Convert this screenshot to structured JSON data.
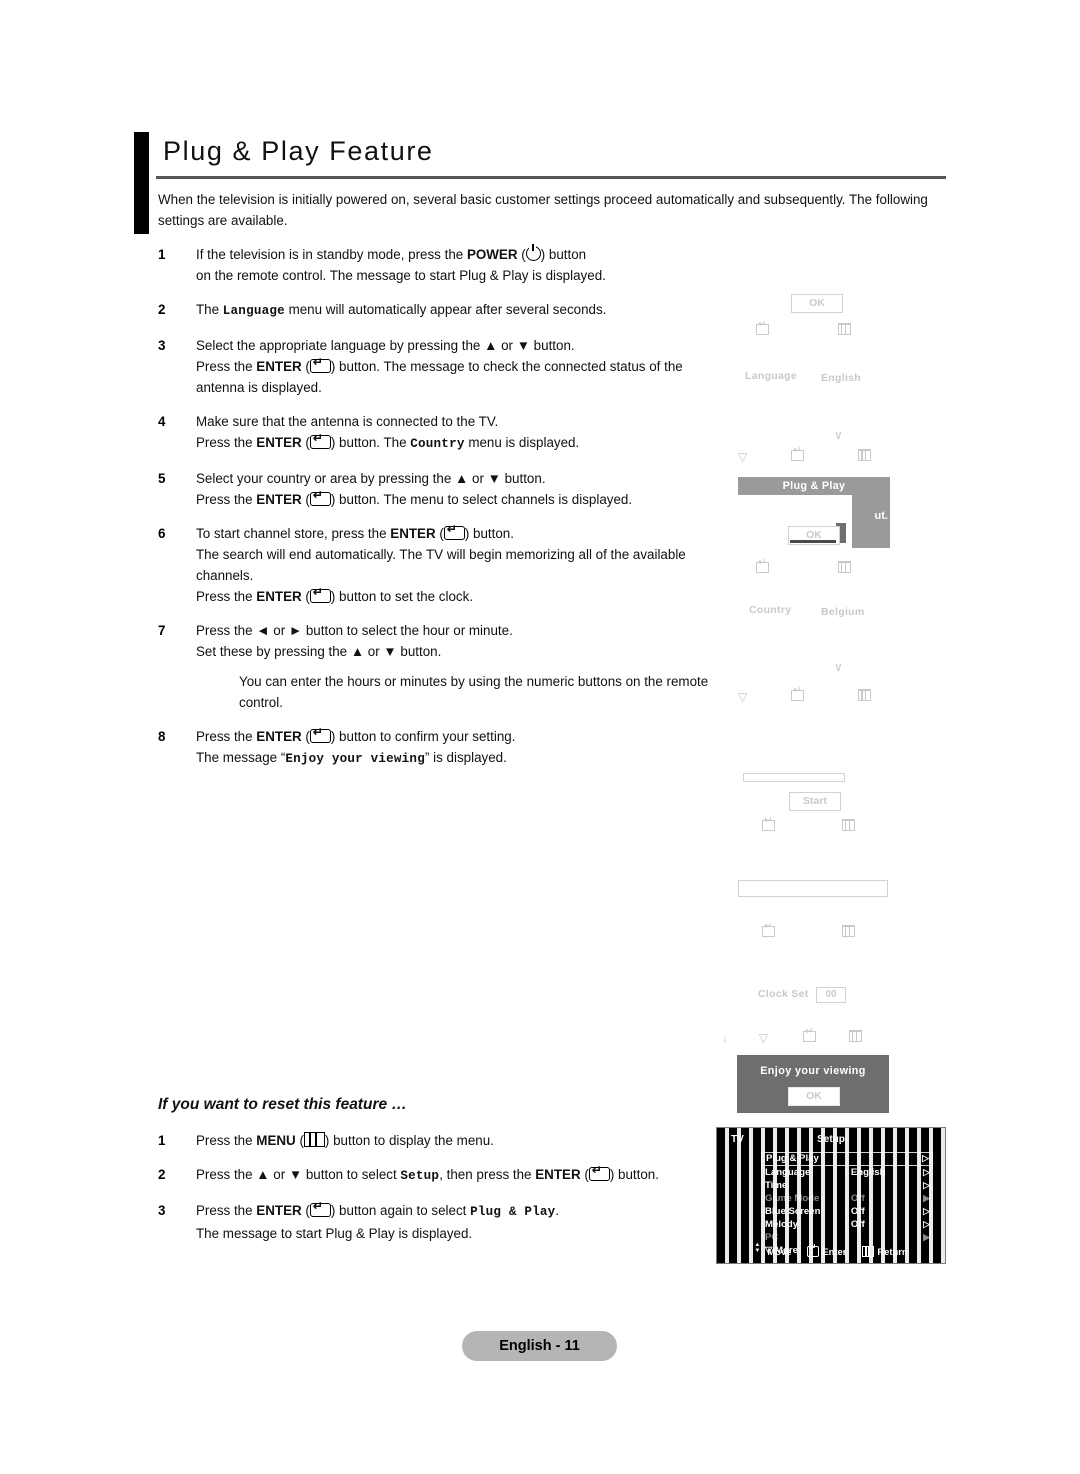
{
  "header": {
    "title": "Plug & Play Feature",
    "intro": "When the television is initially powered on, several basic customer settings proceed automatically and subsequently. The following settings are available."
  },
  "steps_main": [
    {
      "num": "1",
      "line1_a": "If the television is in standby mode, press the ",
      "bold1": "POWER",
      "line1_b": " (",
      "icon1": "power-icon",
      "line1_c": ") button",
      "line2": "on the remote control. The message to start Plug & Play is displayed."
    },
    {
      "num": "2",
      "pre": "The ",
      "mono": "Language",
      "post": " menu will automatically appear after several seconds."
    },
    {
      "num": "3",
      "l1": "Select the appropriate language by pressing the ▲ or ▼ button.",
      "l2a": "Press the ",
      "l2b": "ENTER",
      "l2c": " (",
      "l2d": ") button. The message to check the connected status of the antenna is displayed."
    },
    {
      "num": "4",
      "l1": "Make sure that the antenna is connected to the TV.",
      "l2a": "Press the ",
      "l2b": "ENTER",
      "l2c": " (",
      "l2d": ") button. The ",
      "l2mono": "Country",
      "l2e": " menu is displayed."
    },
    {
      "num": "5",
      "l1": "Select your country or area by pressing the ▲ or ▼ button.",
      "l2a": "Press the ",
      "l2b": "ENTER",
      "l2c": " (",
      "l2d": ") button. The menu to select channels is displayed."
    },
    {
      "num": "6",
      "l1a": "To start channel store, press the ",
      "l1b": "ENTER",
      "l1c": " (",
      "l1d": ") button.",
      "l2": "The search will end automatically. The TV will begin memorizing all of the available channels.",
      "l3a": "Press the ",
      "l3b": "ENTER",
      "l3c": " (",
      "l3d": ") button to set the clock."
    },
    {
      "num": "7",
      "l1": "Press the ◄ or ► button to select the hour or minute.",
      "l2": "Set these by pressing the ▲ or ▼ button.",
      "note": "You can enter the hours or minutes by using the numeric buttons on the remote control."
    },
    {
      "num": "8",
      "l1a": "Press the ",
      "l1b": "ENTER",
      "l1c": " (",
      "l1d": ") button to confirm your setting.",
      "l2a": "The message “",
      "l2mono": "Enjoy your viewing",
      "l2b": "” is displayed."
    }
  ],
  "reset": {
    "heading": "If you want to reset this feature …",
    "steps": [
      {
        "num": "1",
        "a": "Press the ",
        "b": "MENU",
        "c": " (",
        "d": ") button to display the menu."
      },
      {
        "num": "2",
        "a": "Press the ▲ or ▼ button to select ",
        "mono": "Setup",
        "b": ", then press the ",
        "bold": "ENTER",
        "c": " (",
        "d": ") button."
      },
      {
        "num": "3",
        "a": "Press the ",
        "bold": "ENTER",
        "c": " (",
        "d": ") button again to select ",
        "mono": "Plug & Play",
        "e": ".",
        "l2": "The message to start Plug & Play is displayed."
      }
    ]
  },
  "osd": {
    "ok_label": "OK",
    "start_label": "Start",
    "language_label": "Language",
    "language_value": "English",
    "country_label": "Country",
    "country_value": "Belgium",
    "clock_label": "Clock Set",
    "clock_value": "00",
    "pnp_title": "Plug & Play",
    "pnp_fragment": "ut.",
    "enjoy_text": "Enjoy your viewing",
    "enjoy_ok": "OK"
  },
  "tv_menu": {
    "source_label": "TV",
    "heading": "Setup",
    "rows": [
      {
        "label": "Plug & Play",
        "value": "",
        "selected": true,
        "dim": false,
        "arrow": "▷"
      },
      {
        "label": "Language",
        "value": ": English",
        "selected": false,
        "dim": false,
        "arrow": "▷"
      },
      {
        "label": "Time",
        "value": "",
        "selected": false,
        "dim": false,
        "arrow": "▷"
      },
      {
        "label": "Game Mode",
        "value": ": Off",
        "selected": false,
        "dim": true,
        "arrow": "▶"
      },
      {
        "label": "Blue Screen",
        "value": ": Off",
        "selected": false,
        "dim": false,
        "arrow": "▷"
      },
      {
        "label": "Melody",
        "value": ": Off",
        "selected": false,
        "dim": false,
        "arrow": "▷"
      },
      {
        "label": "PC",
        "value": "",
        "selected": false,
        "dim": true,
        "arrow": "▶"
      }
    ],
    "more_label": "▽ More",
    "hints": [
      {
        "icon": "updown-icon",
        "label": "Move"
      },
      {
        "icon": "enter-icon",
        "label": "Enter"
      },
      {
        "icon": "menu-icon",
        "label": "Return"
      }
    ]
  },
  "footer": {
    "page_label": "English - 11"
  },
  "colors": {
    "osd_gray": "#9a9a9a",
    "dialog_gray": "#6e6e6e",
    "footer_pill": "#b5b5b5",
    "rule": "#555555"
  }
}
